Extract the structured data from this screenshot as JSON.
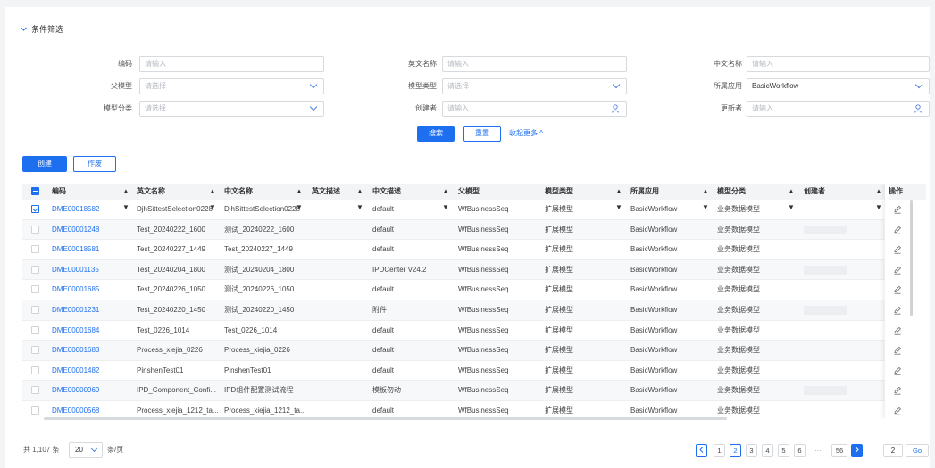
{
  "filter": {
    "title": "条件筛选",
    "fields": [
      {
        "label": "编码",
        "placeholder": "请输入",
        "value": ""
      },
      {
        "label": "英文名称",
        "placeholder": "请输入",
        "value": ""
      },
      {
        "label": "中文名称",
        "placeholder": "请输入",
        "value": ""
      },
      {
        "label": "父模型",
        "placeholder": "请选择",
        "value": ""
      },
      {
        "label": "模型类型",
        "placeholder": "请选择",
        "value": ""
      },
      {
        "label": "所属应用",
        "placeholder": "",
        "value": "BasicWorkflow"
      },
      {
        "label": "模型分类",
        "placeholder": "请选择",
        "value": ""
      },
      {
        "label": "创建者",
        "placeholder": "请输入",
        "value": ""
      },
      {
        "label": "更新者",
        "placeholder": "请输入",
        "value": ""
      }
    ],
    "search_label": "搜索",
    "reset_label": "重置",
    "collapse_label": "收起更多 ^"
  },
  "toolbar": {
    "create_label": "创建",
    "void_label": "作废"
  },
  "table": {
    "columns": [
      "编码",
      "英文名称",
      "中文名称",
      "英文描述",
      "中文描述",
      "父模型",
      "模型类型",
      "所属应用",
      "模型分类",
      "创建者",
      "操作"
    ],
    "rows": [
      {
        "checked": true,
        "code": "DME00018582",
        "en": "DjhSittestSelection0228",
        "cn": "DjhSittestSelection0228",
        "en_desc": "",
        "cn_desc": "default",
        "parent": "WfBusinessSeq",
        "type": "扩展模型",
        "app": "BasicWorkflow",
        "cat": "业务数据模型",
        "creator_redacted": false
      },
      {
        "checked": false,
        "code": "DME00001248",
        "en": "Test_20240222_1600",
        "cn": "测试_20240222_1600",
        "en_desc": "",
        "cn_desc": "default",
        "parent": "WfBusinessSeq",
        "type": "扩展模型",
        "app": "BasicWorkflow",
        "cat": "业务数据模型",
        "creator_redacted": true
      },
      {
        "checked": false,
        "code": "DME00018581",
        "en": "Test_20240227_1449",
        "cn": "Test_20240227_1449",
        "en_desc": "",
        "cn_desc": "default",
        "parent": "WfBusinessSeq",
        "type": "扩展模型",
        "app": "BasicWorkflow",
        "cat": "业务数据模型",
        "creator_redacted": false
      },
      {
        "checked": false,
        "code": "DME00001135",
        "en": "Test_20240204_1800",
        "cn": "测试_20240204_1800",
        "en_desc": "",
        "cn_desc": "IPDCenter V24.2",
        "parent": "WfBusinessSeq",
        "type": "扩展模型",
        "app": "BasicWorkflow",
        "cat": "业务数据模型",
        "creator_redacted": true
      },
      {
        "checked": false,
        "code": "DME00001685",
        "en": "Test_20240226_1050",
        "cn": "测试_20240226_1050",
        "en_desc": "",
        "cn_desc": "default",
        "parent": "WfBusinessSeq",
        "type": "扩展模型",
        "app": "BasicWorkflow",
        "cat": "业务数据模型",
        "creator_redacted": false
      },
      {
        "checked": false,
        "code": "DME00001231",
        "en": "Test_20240220_1450",
        "cn": "测试_20240220_1450",
        "en_desc": "",
        "cn_desc": "附件",
        "parent": "WfBusinessSeq",
        "type": "扩展模型",
        "app": "BasicWorkflow",
        "cat": "业务数据模型",
        "creator_redacted": true
      },
      {
        "checked": false,
        "code": "DME00001684",
        "en": "Test_0226_1014",
        "cn": "Test_0226_1014",
        "en_desc": "",
        "cn_desc": "default",
        "parent": "WfBusinessSeq",
        "type": "扩展模型",
        "app": "BasicWorkflow",
        "cat": "业务数据模型",
        "creator_redacted": false
      },
      {
        "checked": false,
        "code": "DME00001683",
        "en": "Process_xiejia_0226",
        "cn": "Process_xiejia_0226",
        "en_desc": "",
        "cn_desc": "default",
        "parent": "WfBusinessSeq",
        "type": "扩展模型",
        "app": "BasicWorkflow",
        "cat": "业务数据模型",
        "creator_redacted": false
      },
      {
        "checked": false,
        "code": "DME00001482",
        "en": "PinshenTest01",
        "cn": "PinshenTest01",
        "en_desc": "",
        "cn_desc": "default",
        "parent": "WfBusinessSeq",
        "type": "扩展模型",
        "app": "BasicWorkflow",
        "cat": "业务数据模型",
        "creator_redacted": false
      },
      {
        "checked": false,
        "code": "DME00000969",
        "en": "IPD_Component_Confi...",
        "cn": "IPD组件配置测试流程",
        "en_desc": "",
        "cn_desc": "模板勿动",
        "parent": "WfBusinessSeq",
        "type": "扩展模型",
        "app": "BasicWorkflow",
        "cat": "业务数据模型",
        "creator_redacted": true
      },
      {
        "checked": false,
        "code": "DME00000568",
        "en": "Process_xiejia_1212_ta...",
        "cn": "Process_xiejia_1212_ta...",
        "en_desc": "",
        "cn_desc": "default",
        "parent": "WfBusinessSeq",
        "type": "扩展模型",
        "app": "BasicWorkflow",
        "cat": "业务数据模型",
        "creator_redacted": false
      }
    ]
  },
  "pagination": {
    "total": "共 1,107 条",
    "page_size": "20",
    "per_page_label": "条/页",
    "pages": [
      "1",
      "2",
      "3",
      "4",
      "5",
      "6"
    ],
    "ellipsis": "···",
    "last_page": "56",
    "current": "2",
    "jump_value": "2",
    "go_label": "Go"
  },
  "colors": {
    "primary": "#1e6ff0",
    "link": "#1e6ff0",
    "header_bg": "#f3f4f6",
    "row_alt": "#f7f8fa"
  },
  "icons": [
    "chevron-down-icon",
    "person-icon",
    "edit-icon",
    "sort-icon",
    "checkbox-icon",
    "chevron-left-icon",
    "chevron-right-icon"
  ]
}
